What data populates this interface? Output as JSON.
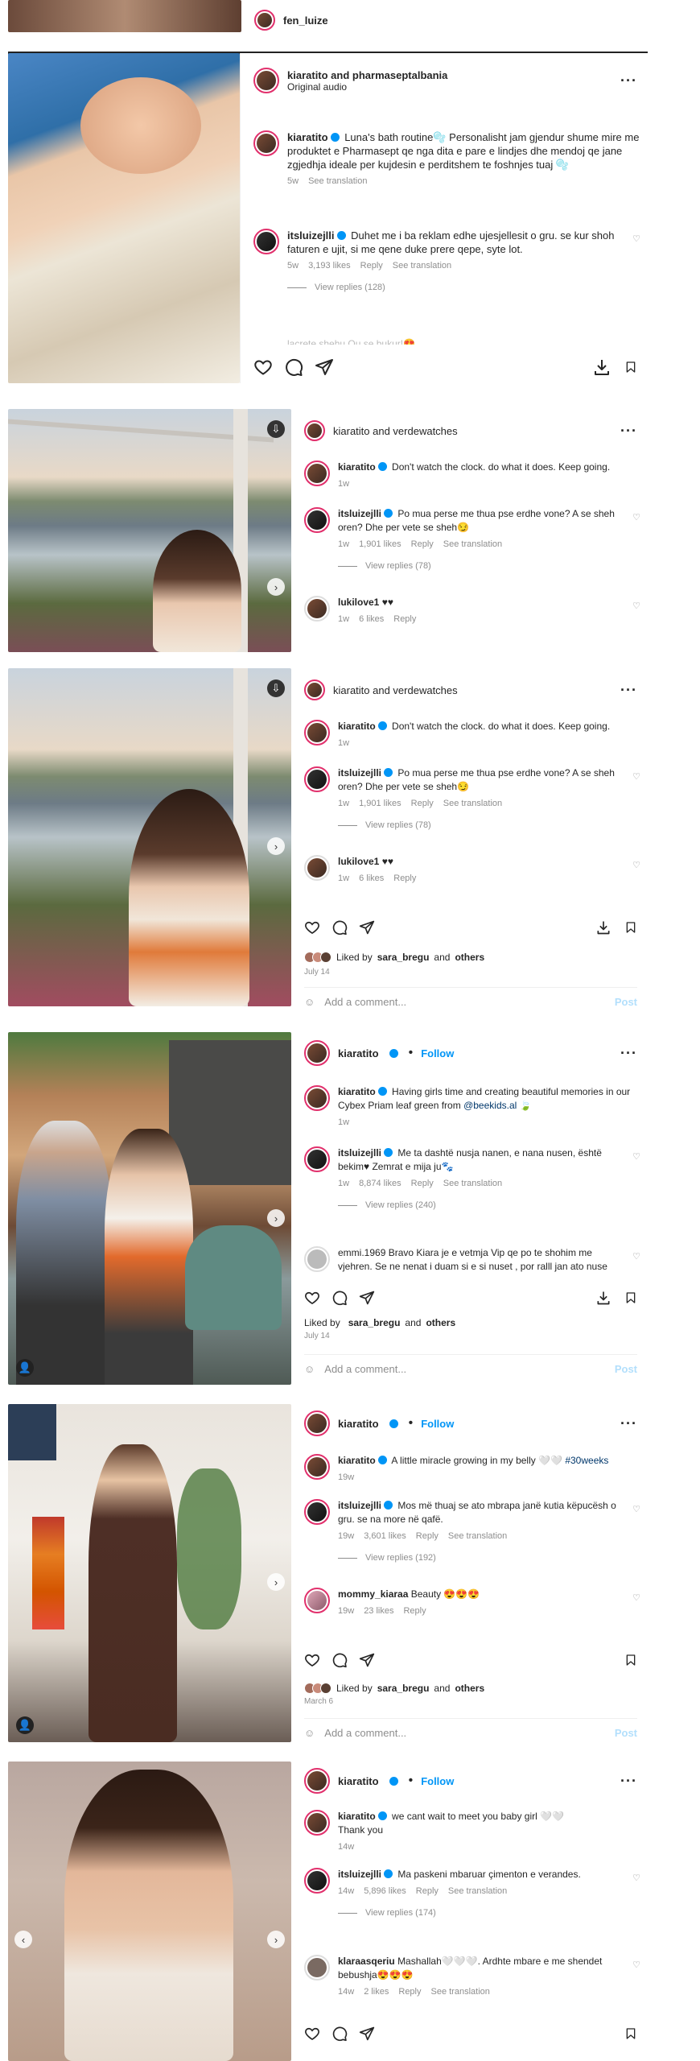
{
  "post0": {
    "user": "fen_luize"
  },
  "post1": {
    "header": "kiaratito and pharmaseptalbania",
    "audio": "Original audio",
    "c1": {
      "user": "kiaratito",
      "text": "Luna's bath routine🫧 Personalisht jam gjendur shume mire me produktet e Pharmasept qe nga dita e pare e lindjes dhe mendoj qe jane zgjedhja ideale per kujdesin e perditshem te foshnjes tuaj 🫧",
      "time": "5w",
      "trans": "See translation"
    },
    "c2": {
      "user": "itsluizejlli",
      "text": "Duhet me i ba reklam edhe ujesjellesit o gru. se kur shoh faturen e ujit, si me qene duke prere qepe, syte lot.",
      "time": "5w",
      "likes": "3,193 likes",
      "reply": "Reply",
      "trans": "See translation",
      "replies": "View replies (128)"
    },
    "cut": "lacrete.shehu Ou se bukur!😍 ..."
  },
  "post2": {
    "header": "kiaratito and verdewatches",
    "c1": {
      "user": "kiaratito",
      "text": "Don't watch the clock. do what it does. Keep going.",
      "time": "1w"
    },
    "c2": {
      "user": "itsluizejlli",
      "text": "Po mua perse me thua pse erdhe vone? A se sheh oren? Dhe per vete se sheh😏",
      "time": "1w",
      "likes": "1,901 likes",
      "reply": "Reply",
      "trans": "See translation",
      "replies": "View replies (78)"
    },
    "c3": {
      "user": "lukilove1",
      "text": "♥♥",
      "time": "1w",
      "likes": "6 likes",
      "reply": "Reply"
    }
  },
  "post3": {
    "header": "kiaratito and verdewatches",
    "c1": {
      "user": "kiaratito",
      "text": "Don't watch the clock. do what it does. Keep going.",
      "time": "1w"
    },
    "c2": {
      "user": "itsluizejlli",
      "text": "Po mua perse me thua pse erdhe vone? A se sheh oren? Dhe per vete se sheh😏",
      "time": "1w",
      "likes": "1,901 likes",
      "reply": "Reply",
      "trans": "See translation",
      "replies": "View replies (78)"
    },
    "c3": {
      "user": "lukilove1",
      "text": "♥♥",
      "time": "1w",
      "likes": "6 likes",
      "reply": "Reply"
    },
    "liked_prefix": "Liked by",
    "liked_user": "sara_bregu",
    "liked_and": "and",
    "liked_others": "others",
    "date": "July 14",
    "add": "Add a comment...",
    "post": "Post"
  },
  "post4": {
    "user": "kiaratito",
    "follow": "Follow",
    "c1": {
      "user": "kiaratito",
      "text": "Having girls time and creating beautiful memories in our Cybex Priam leaf green from",
      "tag": "@beekids.al",
      "tail": " 🍃",
      "time": "1w"
    },
    "c2": {
      "user": "itsluizejlli",
      "text": "Me ta dashtë nusja nanen, e nana nusen, është bekim♥ Zemrat e mija ju🐾",
      "time": "1w",
      "likes": "8,874 likes",
      "reply": "Reply",
      "trans": "See translation",
      "replies": "View replies (240)"
    },
    "c3": {
      "user": "emmi.1969",
      "text": "Bravo Kiara je e vetmja Vip qe po te shohim me vjehren. Se ne nenat i duam si e si nuset , por ralll jan ato nuse"
    },
    "liked_prefix": "Liked by",
    "liked_user": "sara_bregu",
    "liked_and": "and",
    "liked_others": "others",
    "date": "July 14",
    "add": "Add a comment...",
    "post": "Post"
  },
  "post5": {
    "user": "kiaratito",
    "follow": "Follow",
    "c1": {
      "user": "kiaratito",
      "text": "A little miracle growing in my belly 🤍🤍",
      "tag": "#30weeks",
      "time": "19w"
    },
    "c2": {
      "user": "itsluizejlli",
      "text": "Mos më thuaj se ato mbrapa janë kutia këpucësh o gru. se na more në qafë.",
      "time": "19w",
      "likes": "3,601 likes",
      "reply": "Reply",
      "trans": "See translation",
      "replies": "View replies (192)"
    },
    "c3": {
      "user": "mommy_kiaraa",
      "text": "Beauty 😍😍😍",
      "time": "19w",
      "likes": "23 likes",
      "reply": "Reply"
    },
    "liked_prefix": "Liked by",
    "liked_user": "sara_bregu",
    "liked_and": "and",
    "liked_others": "others",
    "date": "March 6",
    "add": "Add a comment...",
    "post": "Post"
  },
  "post6": {
    "user": "kiaratito",
    "follow": "Follow",
    "c1": {
      "user": "kiaratito",
      "text": "we cant wait to meet you baby girl 🤍🤍",
      "text2": "Thank you",
      "time": "14w"
    },
    "c2": {
      "user": "itsluizejlli",
      "text": "Ma paskeni mbaruar çimenton e verandes.",
      "time": "14w",
      "likes": "5,896 likes",
      "reply": "Reply",
      "trans": "See translation",
      "replies": "View replies (174)"
    },
    "c3": {
      "user": "klaraasqeriu",
      "text": "Mashallah🤍🤍🤍. Ardhte mbare e me shendet bebushja😍😍😍",
      "time": "14w",
      "likes": "2 likes",
      "reply": "Reply",
      "trans": "See translation"
    }
  },
  "colors": {
    "accent": "#0095f6",
    "story_ring": "#e1306c",
    "muted": "#8e8e8e"
  }
}
